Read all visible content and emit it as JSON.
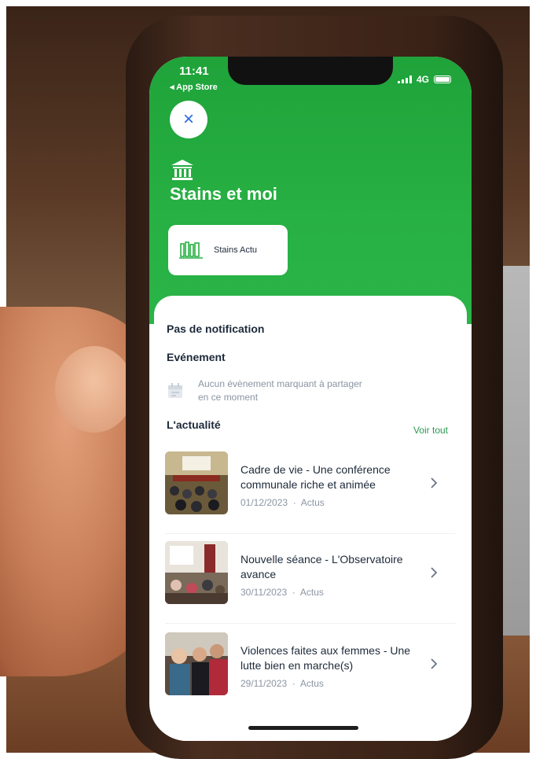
{
  "status": {
    "time": "11:41",
    "back_app": "◂ App Store",
    "network": "4G"
  },
  "header": {
    "close_glyph": "×",
    "title": "Stains et moi",
    "chip_label": "Stains Actu"
  },
  "sheet": {
    "notifications_title": "Pas de notification",
    "events_title": "Evénement",
    "events_empty": "Aucun évènement marquant à partager en ce moment",
    "news_title": "L'actualité",
    "see_all": "Voir tout",
    "news": [
      {
        "title": "Cadre de vie - Une conférence communale riche et animée",
        "date": "01/12/2023",
        "category": "Actus"
      },
      {
        "title": "Nouvelle séance - L'Observatoire avance",
        "date": "30/11/2023",
        "category": "Actus"
      },
      {
        "title": "Violences faites aux femmes - Une lutte bien en marche(s)",
        "date": "29/11/2023",
        "category": "Actus"
      }
    ],
    "meta_separator": "·"
  },
  "colors": {
    "brand_green": "#27b043",
    "link_green": "#2a9a50",
    "text_dark": "#1d2a3a",
    "text_muted": "#8a95a3"
  },
  "icons": {
    "close": "close-icon",
    "institution": "bank-icon",
    "chip": "library-icon",
    "calendar": "calendar-icon",
    "chevron": "chevron-right-icon"
  }
}
